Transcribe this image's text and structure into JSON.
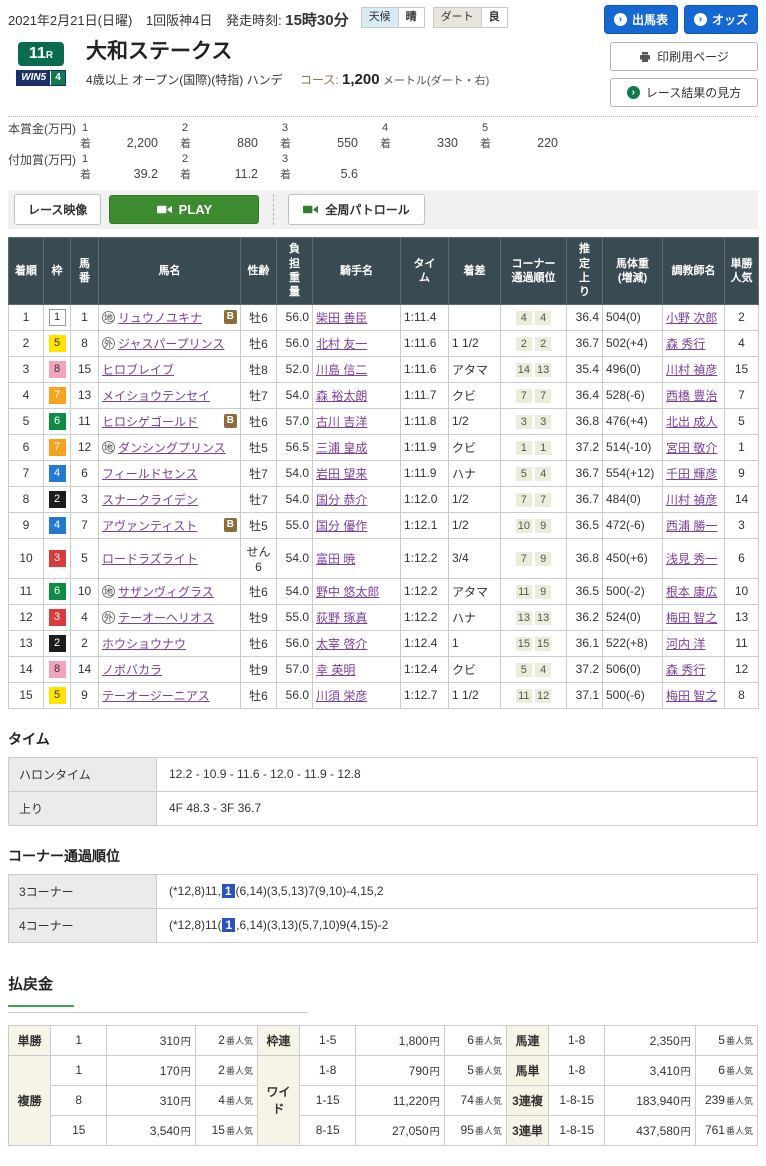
{
  "header": {
    "date": "2021年2月21日(日曜)",
    "meeting": "1回阪神4日",
    "start_label": "発走時刻:",
    "start_time": "15時30分",
    "weather_label": "天候",
    "weather_value": "晴",
    "track_label": "ダート",
    "track_value": "良",
    "buttons": {
      "entries": "出馬表",
      "odds": "オッズ",
      "print": "印刷用ページ",
      "guide": "レース結果の見方"
    }
  },
  "race": {
    "number": "11",
    "number_suffix": "R",
    "win5_text": "WIN5",
    "win5_num": "4",
    "title": "大和ステークス",
    "grade_text": "4歳以上 オープン(国際)(特指) ハンデ",
    "course_label": "コース:",
    "course_value": "1,200",
    "course_unit": "メートル(ダート・右)"
  },
  "prizes": {
    "main_label": "本賞金(万円)",
    "added_label": "付加賞(万円)",
    "rank_suffix": "着",
    "main": [
      {
        "rank": "1",
        "value": "2,200"
      },
      {
        "rank": "2",
        "value": "880"
      },
      {
        "rank": "3",
        "value": "550"
      },
      {
        "rank": "4",
        "value": "330"
      },
      {
        "rank": "5",
        "value": "220"
      }
    ],
    "added": [
      {
        "rank": "1",
        "value": "39.2"
      },
      {
        "rank": "2",
        "value": "11.2"
      },
      {
        "rank": "3",
        "value": "5.6"
      }
    ]
  },
  "video": {
    "race_video": "レース映像",
    "play": "PLAY",
    "patrol": "全周パトロール"
  },
  "results": {
    "headers": [
      "着順",
      "枠",
      "馬\n番",
      "馬名",
      "性齢",
      "負\n担\n重\n量",
      "騎手名",
      "タイ\nム",
      "着差",
      "コーナー\n通過順位",
      "推\n定\n上\nり",
      "馬体重\n(増減)",
      "調教師名",
      "単勝\n人気"
    ],
    "rows": [
      {
        "pos": "1",
        "frame": "1",
        "num": "1",
        "prefix": "地",
        "name": "リュウノユキナ",
        "blinker": "B",
        "sexage": "牡6",
        "weight": "56.0",
        "jockey": "柴田 善臣",
        "time": "1:11.4",
        "margin": "",
        "c3": "4",
        "c4": "4",
        "agari": "36.4",
        "horse_weight": "504(0)",
        "trainer": "小野 次郎",
        "pop": "2"
      },
      {
        "pos": "2",
        "frame": "5",
        "num": "8",
        "prefix": "外",
        "name": "ジャスパープリンス",
        "blinker": "",
        "sexage": "牡6",
        "weight": "56.0",
        "jockey": "北村 友一",
        "time": "1:11.6",
        "margin": "1 1/2",
        "c3": "2",
        "c4": "2",
        "agari": "36.7",
        "horse_weight": "502(+4)",
        "trainer": "森 秀行",
        "pop": "4"
      },
      {
        "pos": "3",
        "frame": "8",
        "num": "15",
        "prefix": "",
        "name": "ヒロブレイブ",
        "blinker": "",
        "sexage": "牡8",
        "weight": "52.0",
        "jockey": "川島 信二",
        "time": "1:11.6",
        "margin": "アタマ",
        "c3": "14",
        "c4": "13",
        "agari": "35.4",
        "horse_weight": "496(0)",
        "trainer": "川村 禎彦",
        "pop": "15"
      },
      {
        "pos": "4",
        "frame": "7",
        "num": "13",
        "prefix": "",
        "name": "メイショウテンセイ",
        "blinker": "",
        "sexage": "牡7",
        "weight": "54.0",
        "jockey": "森 裕太朗",
        "time": "1:11.7",
        "margin": "クビ",
        "c3": "7",
        "c4": "7",
        "agari": "36.4",
        "horse_weight": "528(-6)",
        "trainer": "西橋 豊治",
        "pop": "7"
      },
      {
        "pos": "5",
        "frame": "6",
        "num": "11",
        "prefix": "",
        "name": "ヒロシゲゴールド",
        "blinker": "B",
        "sexage": "牡6",
        "weight": "57.0",
        "jockey": "古川 吉洋",
        "time": "1:11.8",
        "margin": "1/2",
        "c3": "3",
        "c4": "3",
        "agari": "36.8",
        "horse_weight": "476(+4)",
        "trainer": "北出 成人",
        "pop": "5"
      },
      {
        "pos": "6",
        "frame": "7",
        "num": "12",
        "prefix": "地",
        "name": "ダンシングプリンス",
        "blinker": "",
        "sexage": "牡5",
        "weight": "56.5",
        "jockey": "三浦 皇成",
        "time": "1:11.9",
        "margin": "クビ",
        "c3": "1",
        "c4": "1",
        "agari": "37.2",
        "horse_weight": "514(-10)",
        "trainer": "宮田 敬介",
        "pop": "1"
      },
      {
        "pos": "7",
        "frame": "4",
        "num": "6",
        "prefix": "",
        "name": "フィールドセンス",
        "blinker": "",
        "sexage": "牡7",
        "weight": "54.0",
        "jockey": "岩田 望来",
        "time": "1:11.9",
        "margin": "ハナ",
        "c3": "5",
        "c4": "4",
        "agari": "36.7",
        "horse_weight": "554(+12)",
        "trainer": "千田 輝彦",
        "pop": "9"
      },
      {
        "pos": "8",
        "frame": "2",
        "num": "3",
        "prefix": "",
        "name": "スナークライデン",
        "blinker": "",
        "sexage": "牡7",
        "weight": "54.0",
        "jockey": "国分 恭介",
        "time": "1:12.0",
        "margin": "1/2",
        "c3": "7",
        "c4": "7",
        "agari": "36.7",
        "horse_weight": "484(0)",
        "trainer": "川村 禎彦",
        "pop": "14"
      },
      {
        "pos": "9",
        "frame": "4",
        "num": "7",
        "prefix": "",
        "name": "アヴァンティスト",
        "blinker": "B",
        "sexage": "牡5",
        "weight": "55.0",
        "jockey": "国分 優作",
        "time": "1:12.1",
        "margin": "1/2",
        "c3": "10",
        "c4": "9",
        "agari": "36.5",
        "horse_weight": "472(-6)",
        "trainer": "西浦 勝一",
        "pop": "3"
      },
      {
        "pos": "10",
        "frame": "3",
        "num": "5",
        "prefix": "",
        "name": "ロードラズライト",
        "blinker": "",
        "sexage": "せん6",
        "weight": "54.0",
        "jockey": "富田 暁",
        "time": "1:12.2",
        "margin": "3/4",
        "c3": "7",
        "c4": "9",
        "agari": "36.8",
        "horse_weight": "450(+6)",
        "trainer": "浅見 秀一",
        "pop": "6"
      },
      {
        "pos": "11",
        "frame": "6",
        "num": "10",
        "prefix": "地",
        "name": "サザンヴィグラス",
        "blinker": "",
        "sexage": "牡6",
        "weight": "54.0",
        "jockey": "野中 悠太郎",
        "time": "1:12.2",
        "margin": "アタマ",
        "c3": "11",
        "c4": "9",
        "agari": "36.5",
        "horse_weight": "500(-2)",
        "trainer": "根本 康広",
        "pop": "10"
      },
      {
        "pos": "12",
        "frame": "3",
        "num": "4",
        "prefix": "外",
        "name": "テーオーヘリオス",
        "blinker": "",
        "sexage": "牡9",
        "weight": "55.0",
        "jockey": "荻野 琢真",
        "time": "1:12.2",
        "margin": "ハナ",
        "c3": "13",
        "c4": "13",
        "agari": "36.2",
        "horse_weight": "524(0)",
        "trainer": "梅田 智之",
        "pop": "13"
      },
      {
        "pos": "13",
        "frame": "2",
        "num": "2",
        "prefix": "",
        "name": "ホウショウナウ",
        "blinker": "",
        "sexage": "牡6",
        "weight": "56.0",
        "jockey": "太宰 啓介",
        "time": "1:12.4",
        "margin": "1",
        "c3": "15",
        "c4": "15",
        "agari": "36.1",
        "horse_weight": "522(+8)",
        "trainer": "河内 洋",
        "pop": "11"
      },
      {
        "pos": "14",
        "frame": "8",
        "num": "14",
        "prefix": "",
        "name": "ノボバカラ",
        "blinker": "",
        "sexage": "牡9",
        "weight": "57.0",
        "jockey": "幸 英明",
        "time": "1:12.4",
        "margin": "クビ",
        "c3": "5",
        "c4": "4",
        "agari": "37.2",
        "horse_weight": "506(0)",
        "trainer": "森 秀行",
        "pop": "12"
      },
      {
        "pos": "15",
        "frame": "5",
        "num": "9",
        "prefix": "",
        "name": "テーオージーニアス",
        "blinker": "",
        "sexage": "牡6",
        "weight": "56.0",
        "jockey": "川須 栄彦",
        "time": "1:12.7",
        "margin": "1 1/2",
        "c3": "11",
        "c4": "12",
        "agari": "37.1",
        "horse_weight": "500(-6)",
        "trainer": "梅田 智之",
        "pop": "8"
      }
    ]
  },
  "time_section": {
    "heading": "タイム",
    "rows": [
      {
        "label": "ハロンタイム",
        "value": "12.2 - 10.9 - 11.6 - 12.0 - 11.9 - 12.8"
      },
      {
        "label": "上り",
        "value": "4F 48.3 - 3F 36.7"
      }
    ]
  },
  "corner_section": {
    "heading": "コーナー通過順位",
    "rows": [
      {
        "label": "3コーナー",
        "pre": "(*12,8)11,",
        "hl": "1",
        "post": "(6,14)(3,5,13)7(9,10)-4,15,2"
      },
      {
        "label": "4コーナー",
        "pre": "(*12,8)11(",
        "hl": "1",
        "post": ",6,14)(3,13)(5,7,10)9(4,15)-2"
      }
    ]
  },
  "payout": {
    "heading": "払戻金",
    "yen": "円",
    "pop_suffix": "番人気",
    "tansho": {
      "label": "単勝",
      "num": "1",
      "amount": "310",
      "pop": "2"
    },
    "fukusho": {
      "label": "複勝",
      "rows": [
        {
          "num": "1",
          "amount": "170",
          "pop": "2"
        },
        {
          "num": "8",
          "amount": "310",
          "pop": "4"
        },
        {
          "num": "15",
          "amount": "3,540",
          "pop": "15"
        }
      ]
    },
    "wakuren": {
      "label": "枠連",
      "num": "1-5",
      "amount": "1,800",
      "pop": "6"
    },
    "wide": {
      "label": "ワイド",
      "rows": [
        {
          "num": "1-8",
          "amount": "790",
          "pop": "5"
        },
        {
          "num": "1-15",
          "amount": "11,220",
          "pop": "74"
        },
        {
          "num": "8-15",
          "amount": "27,050",
          "pop": "95"
        }
      ]
    },
    "umaren": {
      "label": "馬連",
      "num": "1-8",
      "amount": "2,350",
      "pop": "5"
    },
    "umatan": {
      "label": "馬単",
      "num": "1-8",
      "amount": "3,410",
      "pop": "6"
    },
    "sanrenpuku": {
      "label": "3連複",
      "num": "1-8-15",
      "amount": "183,940",
      "pop": "239"
    },
    "sanrentan": {
      "label": "3連単",
      "num": "1-8-15",
      "amount": "437,580",
      "pop": "761"
    }
  },
  "colors": {
    "accent_blue": "#1568d2",
    "badge_green": "#0a6b4e",
    "play_green": "#3d8b2f",
    "table_header": "#3a4a53",
    "link_purple": "#7b3f9e",
    "corner_highlight": "#2b50c0",
    "frame_1": "#ffffff",
    "frame_2": "#1d1d1d",
    "frame_3": "#d93a3a",
    "frame_4": "#2479d0",
    "frame_5": "#ffe400",
    "frame_6": "#0e8c46",
    "frame_7": "#f8a21f",
    "frame_8": "#f2a3bd"
  }
}
